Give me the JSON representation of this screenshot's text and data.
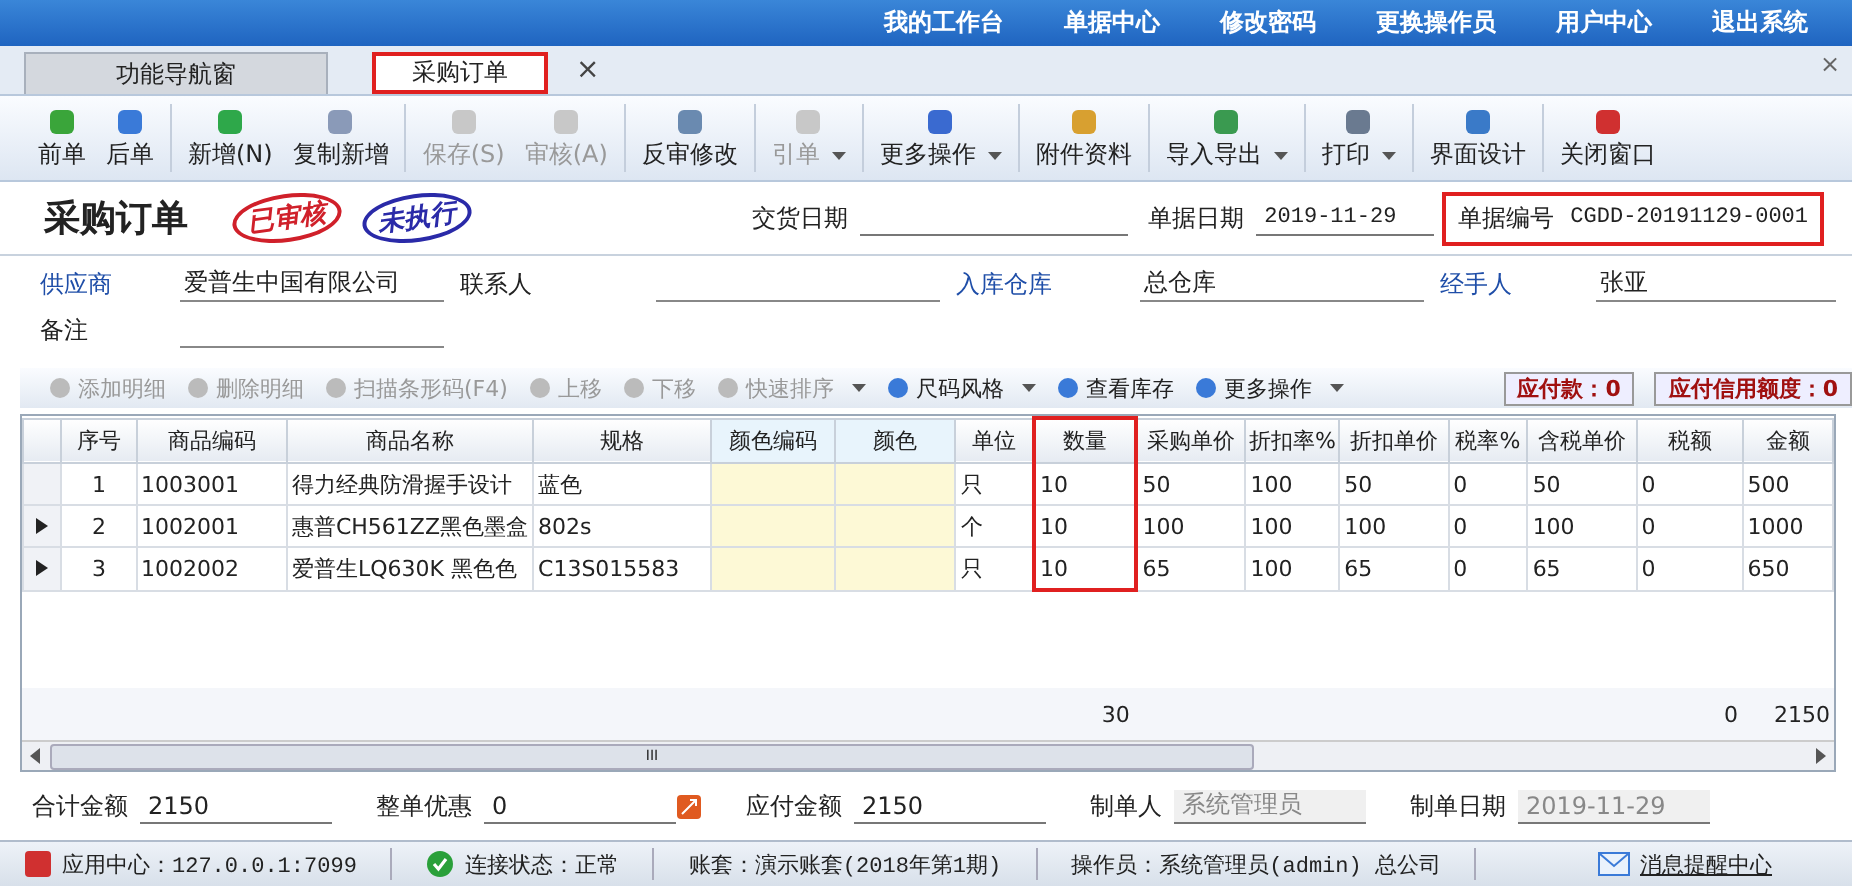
{
  "top_menu": [
    "我的工作台",
    "单据中心",
    "修改密码",
    "更换操作员",
    "用户中心",
    "退出系统"
  ],
  "tabs": [
    {
      "label": "功能导航窗",
      "selected": false,
      "highlighted": false
    },
    {
      "label": "采购订单",
      "selected": true,
      "highlighted": true,
      "close": "×"
    }
  ],
  "window_close": "×",
  "toolbar": [
    {
      "label": "前单",
      "disabled": false,
      "dropdown": false
    },
    {
      "label": "后单",
      "disabled": false,
      "dropdown": false
    },
    {
      "label": "新增(N)",
      "disabled": false,
      "dropdown": false
    },
    {
      "label": "复制新增",
      "disabled": false,
      "dropdown": false
    },
    {
      "label": "保存(S)",
      "disabled": true,
      "dropdown": false
    },
    {
      "label": "审核(A)",
      "disabled": true,
      "dropdown": false
    },
    {
      "label": "反审修改",
      "disabled": false,
      "dropdown": false
    },
    {
      "label": "引单",
      "disabled": true,
      "dropdown": true
    },
    {
      "label": "更多操作",
      "disabled": false,
      "dropdown": true
    },
    {
      "label": "附件资料",
      "disabled": false,
      "dropdown": false
    },
    {
      "label": "导入导出",
      "disabled": false,
      "dropdown": true
    },
    {
      "label": "打印",
      "disabled": false,
      "dropdown": true
    },
    {
      "label": "界面设计",
      "disabled": false,
      "dropdown": false
    },
    {
      "label": "关闭窗口",
      "disabled": false,
      "dropdown": false
    }
  ],
  "header": {
    "title": "采购订单",
    "stamps": [
      {
        "text": "已审核",
        "color": "#d0202a"
      },
      {
        "text": "未执行",
        "color": "#2a2aa8"
      }
    ],
    "delivery_date": {
      "label": "交货日期"
    },
    "doc_date": {
      "label": "单据日期",
      "value": "2019-11-29"
    },
    "doc_number": {
      "label": "单据编号",
      "value": "CGDD-20191129-0001",
      "highlighted": true
    }
  },
  "form": [
    {
      "label": "供应商",
      "value": "爱普生中国有限公司",
      "link": true
    },
    {
      "label": "联系人",
      "link": false
    },
    {
      "label": "入库仓库",
      "value": "总仓库",
      "link": true
    },
    {
      "label": "经手人",
      "value": "张亚",
      "link": true
    },
    {
      "label": "备注",
      "link": false
    }
  ],
  "detail_toolbar": [
    {
      "label": "添加明细",
      "disabled": true,
      "dropdown": false
    },
    {
      "label": "删除明细",
      "disabled": true,
      "dropdown": false
    },
    {
      "label": "扫描条形码(F4)",
      "disabled": true,
      "dropdown": false
    },
    {
      "label": "上移",
      "disabled": true,
      "dropdown": false
    },
    {
      "label": "下移",
      "disabled": true,
      "dropdown": false
    },
    {
      "label": "快速排序",
      "disabled": true,
      "dropdown": true
    },
    {
      "label": "尺码风格",
      "disabled": false,
      "dropdown": true
    },
    {
      "label": "查看库存",
      "disabled": false,
      "dropdown": false
    },
    {
      "label": "更多操作",
      "disabled": false,
      "dropdown": true
    }
  ],
  "badges": [
    "应付款：0",
    "应付信用额度：0"
  ],
  "table": {
    "columns": [
      {
        "label": "序号",
        "highlighted": false,
        "tinted": false
      },
      {
        "label": "商品编码",
        "highlighted": false,
        "tinted": false
      },
      {
        "label": "商品名称",
        "highlighted": false,
        "tinted": false
      },
      {
        "label": "规格",
        "highlighted": false,
        "tinted": false
      },
      {
        "label": "颜色编码",
        "highlighted": false,
        "tinted": true
      },
      {
        "label": "颜色",
        "highlighted": false,
        "tinted": true
      },
      {
        "label": "单位",
        "highlighted": false,
        "tinted": false
      },
      {
        "label": "数量",
        "highlighted": true,
        "tinted": false,
        "total": "30"
      },
      {
        "label": "采购单价",
        "highlighted": false,
        "tinted": false
      },
      {
        "label": "折扣率%",
        "highlighted": false,
        "tinted": false
      },
      {
        "label": "折扣单价",
        "highlighted": false,
        "tinted": false
      },
      {
        "label": "税率%",
        "highlighted": false,
        "tinted": false
      },
      {
        "label": "含税单价",
        "highlighted": false,
        "tinted": false
      },
      {
        "label": "税额",
        "highlighted": false,
        "tinted": false,
        "total": "0"
      },
      {
        "label": "金额",
        "highlighted": false,
        "tinted": false,
        "total": "2150"
      }
    ],
    "rows": [
      {
        "pointer": false,
        "cells": [
          "1",
          "1003001",
          "得力经典防滑握手设计",
          "蓝色",
          "",
          "",
          "只",
          "10",
          "50",
          "100",
          "50",
          "0",
          "50",
          "0",
          "500"
        ]
      },
      {
        "pointer": true,
        "cells": [
          "2",
          "1002001",
          "惠普CH561ZZ黑色墨盒",
          "802s",
          "",
          "",
          "个",
          "10",
          "100",
          "100",
          "100",
          "0",
          "100",
          "0",
          "1000"
        ]
      },
      {
        "pointer": true,
        "cells": [
          "3",
          "1002002",
          "爱普生LQ630K 黑色色",
          "C13S015583",
          "",
          "",
          "只",
          "10",
          "65",
          "100",
          "65",
          "0",
          "65",
          "0",
          "650"
        ]
      }
    ],
    "scroll_grip": "III"
  },
  "footer": [
    {
      "label": "合计金额",
      "value": "2150",
      "readonly": false
    },
    {
      "label": "整单优惠",
      "value": "0",
      "readonly": false
    },
    {
      "label": "应付金额",
      "value": "2150",
      "readonly": false
    },
    {
      "label": "制单人",
      "value": "系统管理员",
      "readonly": true
    },
    {
      "label": "制单日期",
      "value": "2019-11-29",
      "readonly": true
    }
  ],
  "status_bar": [
    "应用中心：127.0.0.1:7099",
    "连接状态：正常",
    "账套：演示账套(2018年第1期)",
    "操作员：系统管理员(admin) 总公司"
  ],
  "status_link": "消息提醒中心"
}
